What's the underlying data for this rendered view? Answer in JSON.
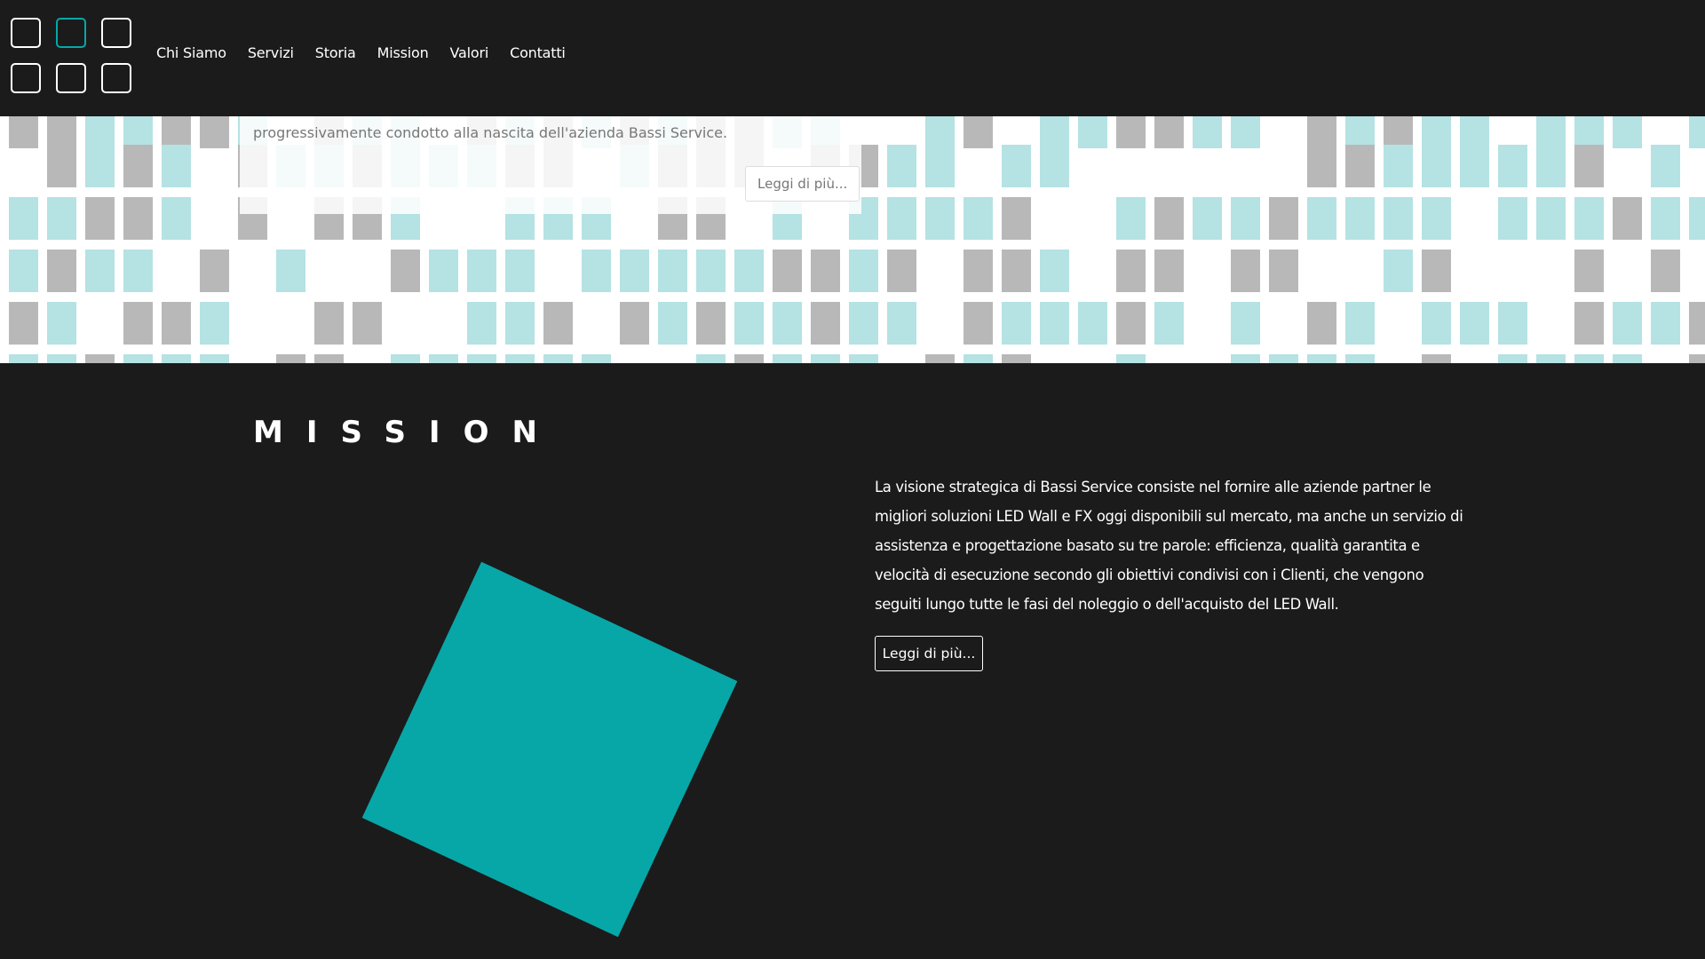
{
  "nav": {
    "items": [
      {
        "label": "Chi Siamo"
      },
      {
        "label": "Servizi"
      },
      {
        "label": "Storia"
      },
      {
        "label": "Mission"
      },
      {
        "label": "Valori"
      },
      {
        "label": "Contatti"
      }
    ]
  },
  "intro": {
    "text": "progressivamente condotto alla nascita dell'azienda Bassi Service.",
    "button_label": "Leggi di più..."
  },
  "mission": {
    "title": "MISSION",
    "body": "La visione strategica di Bassi Service consiste nel fornire alle aziende partner le migliori soluzioni LED Wall e FX oggi disponibili sul mercato, ma anche un servizio di assistenza e progettazione basato su tre parole: efficienza, qualità garantita e velocità di esecuzione secondo gli obiettivi condivisi con i Clienti, che vengono seguiti lungo tutte le fasi del noleggio o dell'acquisto del LED Wall.",
    "button_label": "Leggi di più..."
  },
  "colors": {
    "background": "#1b1b1b",
    "accent": "#07a7a8",
    "tile_cyan": "#b5e2e3",
    "tile_gray": "#b8b8b8"
  }
}
